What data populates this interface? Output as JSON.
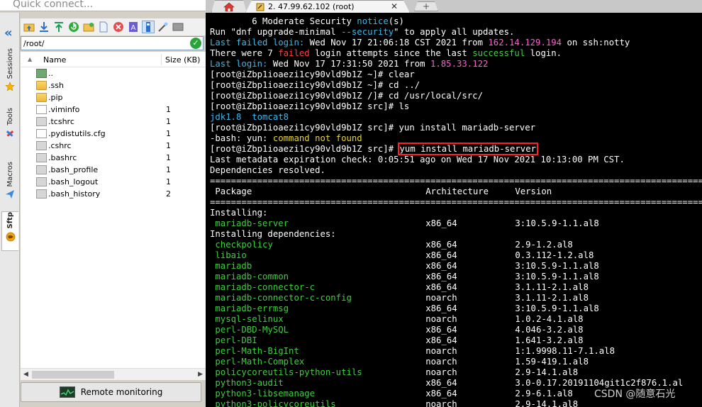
{
  "search": {
    "placeholder": "Quick connect..."
  },
  "sidetabs": [
    {
      "label": "Sessions"
    },
    {
      "label": "Tools"
    },
    {
      "label": "Macros"
    },
    {
      "label": "Sftp"
    }
  ],
  "sftp": {
    "path": "/root/",
    "columns": {
      "name": "Name",
      "size": "Size (KB)"
    },
    "files": [
      {
        "name": "..",
        "size": "",
        "type": "parent"
      },
      {
        "name": ".ssh",
        "size": "",
        "type": "folder"
      },
      {
        "name": ".pip",
        "size": "",
        "type": "folder"
      },
      {
        "name": ".viminfo",
        "size": "1",
        "type": "doc"
      },
      {
        "name": ".tcshrc",
        "size": "1",
        "type": "gdoc"
      },
      {
        "name": ".pydistutils.cfg",
        "size": "1",
        "type": "doc"
      },
      {
        "name": ".cshrc",
        "size": "1",
        "type": "gdoc"
      },
      {
        "name": ".bashrc",
        "size": "1",
        "type": "gdoc"
      },
      {
        "name": ".bash_profile",
        "size": "1",
        "type": "gdoc"
      },
      {
        "name": ".bash_logout",
        "size": "1",
        "type": "gdoc"
      },
      {
        "name": ".bash_history",
        "size": "2",
        "type": "gdoc"
      }
    ],
    "remote_label": "Remote monitoring"
  },
  "tabs": {
    "session_title": "2. 47.99.62.102 (root)"
  },
  "terminal": {
    "l01": {
      "a": "        6 Moderate Security ",
      "b": "notice",
      "c": "(s)"
    },
    "l02": {
      "a": "Run \"dnf upgrade-minimal ",
      "b": "--security",
      "c": "\" to apply all updates."
    },
    "l03": {
      "a": "Last failed login:",
      "b": " Wed Nov 17 21:06:18 CST 2021 ",
      "c": "from",
      "d": " ",
      "e": "162.14.129.194",
      "f": " on ssh:notty"
    },
    "l04": {
      "a": "There were 7 ",
      "b": "failed",
      "c": " login attempts since the last ",
      "d": "successful",
      "e": " login."
    },
    "l05": {
      "a": "Last login:",
      "b": " Wed Nov 17 17:31:50 2021 ",
      "c": "from",
      "d": " ",
      "e": "1.85.33.122"
    },
    "l06": "[root@iZbp1ioaezi1cy90vld9b1Z ~]# clear",
    "l07": "[root@iZbp1ioaezi1cy90vld9b1Z ~]# cd ../",
    "l08": "[root@iZbp1ioaezi1cy90vld9b1Z /]# cd /usr/local/src/",
    "l09": "[root@iZbp1ioaezi1cy90vld9b1Z src]# ls",
    "l10": {
      "a": "jdk1.8",
      "b": "  ",
      "c": "tomcat8"
    },
    "l11": "[root@iZbp1ioaezi1cy90vld9b1Z src]# yun install mariadb-server",
    "l12": {
      "a": "-bash: yun: ",
      "b": "command not found"
    },
    "l13": {
      "a": "[root@iZbp1ioaezi1cy90vld9b1Z src]# ",
      "b": "yum install mariadb-server"
    },
    "l14": "Last metadata expiration check: 0:05:51 ago on Wed 17 Nov 2021 10:13:00 PM CST.",
    "l15": "Dependencies resolved.",
    "sep": "================================================================================================",
    "headers": {
      "pkg": " Package",
      "arch": "Architecture",
      "ver": "Version"
    },
    "installing": "Installing:",
    "installing_deps": "Installing dependencies:",
    "packages": [
      {
        "name": "mariadb-server",
        "arch": "x86_64",
        "ver": "3:10.5.9-1.1.al8"
      },
      {
        "name": "checkpolicy",
        "arch": "x86_64",
        "ver": "2.9-1.2.al8"
      },
      {
        "name": "libaio",
        "arch": "x86_64",
        "ver": "0.3.112-1.2.al8"
      },
      {
        "name": "mariadb",
        "arch": "x86_64",
        "ver": "3:10.5.9-1.1.al8"
      },
      {
        "name": "mariadb-common",
        "arch": "x86_64",
        "ver": "3:10.5.9-1.1.al8"
      },
      {
        "name": "mariadb-connector-c",
        "arch": "x86_64",
        "ver": "3.1.11-2.1.al8"
      },
      {
        "name": "mariadb-connector-c-config",
        "arch": "noarch",
        "ver": "3.1.11-2.1.al8"
      },
      {
        "name": "mariadb-errmsg",
        "arch": "x86_64",
        "ver": "3:10.5.9-1.1.al8"
      },
      {
        "name": "mysql-selinux",
        "arch": "noarch",
        "ver": "1.0.2-4.1.al8"
      },
      {
        "name": "perl-DBD-MySQL",
        "arch": "x86_64",
        "ver": "4.046-3.2.al8"
      },
      {
        "name": "perl-DBI",
        "arch": "x86_64",
        "ver": "1.641-3.2.al8"
      },
      {
        "name": "perl-Math-BigInt",
        "arch": "noarch",
        "ver": "1:1.9998.11-7.1.al8"
      },
      {
        "name": "perl-Math-Complex",
        "arch": "noarch",
        "ver": "1.59-419.1.al8"
      },
      {
        "name": "policycoreutils-python-utils",
        "arch": "noarch",
        "ver": "2.9-14.1.al8"
      },
      {
        "name": "python3-audit",
        "arch": "x86_64",
        "ver": "3.0-0.17.20191104git1c2f876.1.al"
      },
      {
        "name": "python3-libsemanage",
        "arch": "x86_64",
        "ver": "2.9-6.1.al8"
      },
      {
        "name": "python3-policycoreutils",
        "arch": "noarch",
        "ver": "2.9-14.1.al8"
      }
    ]
  },
  "watermark": "CSDN @随意石光"
}
